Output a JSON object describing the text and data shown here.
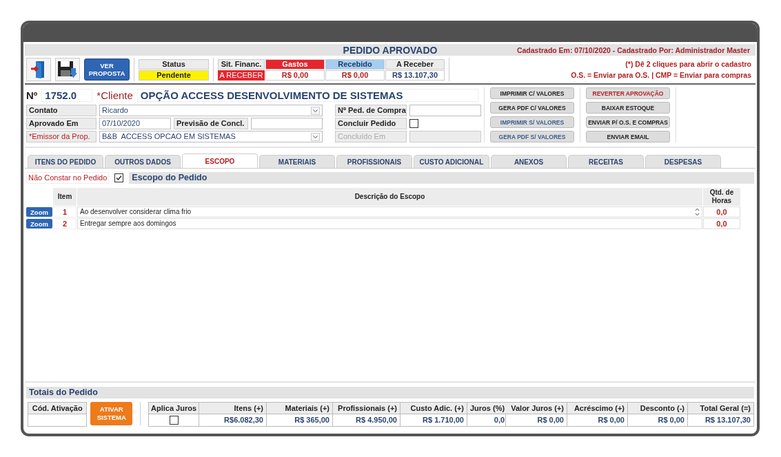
{
  "header": {
    "title": "PEDIDO APROVADO",
    "registered": "Cadastrado Em: 07/10/2020 - Cadastrado Por: Administrador Master"
  },
  "toolbar": {
    "proposal_button": "VER PROPOSTA",
    "status": {
      "label": "Status",
      "value": "Pendente"
    },
    "finance": {
      "label": "Sit. Financ.",
      "state": "A RECEBER",
      "columns": [
        {
          "label": "Gastos",
          "value": "R$ 0,00",
          "kind": "expense"
        },
        {
          "label": "Recebido",
          "value": "R$ 0,00",
          "kind": "received"
        },
        {
          "label": "A Receber",
          "value": "R$ 13.107,30",
          "kind": "due"
        }
      ]
    },
    "notes": [
      "(*) Dê 2 cliques para abrir o cadastro",
      "O.S. = Enviar para O.S. | CMP = Enviar para compras"
    ]
  },
  "order": {
    "number_label": "Nº",
    "number": "1752.0",
    "client_label": "*Cliente",
    "client": "OPÇÃO ACCESS DESENVOLVIMENTO DE SISTEMAS",
    "contact": {
      "label": "Contato",
      "value": "Ricardo",
      "required": false
    },
    "approved": {
      "label": "Aprovado Em",
      "value": "07/10/2020"
    },
    "forecast": {
      "label": "Previsão de Concl."
    },
    "issuer": {
      "label": "*Emissor da Prop.",
      "value": "B&B  ACCESS OPCAO EM SISTEMAS",
      "required": true
    },
    "purchase": {
      "label": "Nº Ped. de Compra"
    },
    "conclude": {
      "label": "Concluir Pedido",
      "checked": false
    },
    "concluded": {
      "label": "Concluído Em",
      "disabled": true
    }
  },
  "print_buttons": [
    {
      "label": "IMPRIMIR C/ VALORES",
      "kind": "plain"
    },
    {
      "label": "GERA PDF C/ VALORES",
      "kind": "plain"
    },
    {
      "label": "IMPRIMIR S/ VALORES",
      "kind": "muted"
    },
    {
      "label": "GERA PDF S/ VALORES",
      "kind": "muted"
    }
  ],
  "action_buttons": [
    {
      "label": "REVERTER APROVAÇÃO",
      "kind": "danger"
    },
    {
      "label": "BAIXAR ESTOQUE",
      "kind": "plain"
    },
    {
      "label": "ENVIAR P/ O.S. E COMPRAS",
      "kind": "plain"
    },
    {
      "label": "ENVIAR EMAIL",
      "kind": "plain"
    }
  ],
  "tabs": [
    {
      "label": "ITENS DO PEDIDO",
      "selected": false
    },
    {
      "label": "OUTROS DADOS",
      "selected": false
    },
    {
      "label": "ESCOPO",
      "selected": true
    },
    {
      "label": "MATERIAIS",
      "selected": false
    },
    {
      "label": "PROFISSIONAIS",
      "selected": false
    },
    {
      "label": "CUSTO ADICIONAL",
      "selected": false
    },
    {
      "label": "ANEXOS",
      "selected": false
    },
    {
      "label": "RECEITAS",
      "selected": false
    },
    {
      "label": "DESPESAS",
      "selected": false
    }
  ],
  "scope": {
    "exclude_label": "Não Constar no Pedido",
    "exclude_checked": true,
    "title": "Escopo do Pedido",
    "columns": [
      "Item",
      "Descrição do Escopo",
      "Qtd. de Horas"
    ],
    "rows": [
      {
        "button": "Zoom",
        "item": "1",
        "description": "Ao desenvolver considerar clima frio",
        "hours": "0,0",
        "scroller": true
      },
      {
        "button": "Zoom",
        "item": "2",
        "description": "Entregar sempre aos domingos",
        "hours": "0,0",
        "scroller": false
      }
    ]
  },
  "totals": {
    "title": "Totais do Pedido",
    "activation_label": "Cód. Ativação",
    "activate_button": "ATIVAR SISTEMA",
    "interest_label": "Aplica Juros",
    "interest_checked": false,
    "columns": [
      {
        "label": "Itens (+)",
        "value": "R$6.082,30"
      },
      {
        "label": "Materiais (+)",
        "value": "R$ 365,00"
      },
      {
        "label": "Profissionais (+)",
        "value": "R$ 4.950,00"
      },
      {
        "label": "Custo Adic. (+)",
        "value": "R$ 1.710,00"
      },
      {
        "label": "Juros (%)",
        "value": "0,0"
      },
      {
        "label": "Valor Juros (+)",
        "value": "R$ 0,00"
      },
      {
        "label": "Acréscimo (+)",
        "value": "R$ 0,00"
      },
      {
        "label": "Desconto (-)",
        "value": "R$ 0,00"
      },
      {
        "label": "Total Geral (=)",
        "value": "R$ 13.107,30"
      }
    ]
  }
}
